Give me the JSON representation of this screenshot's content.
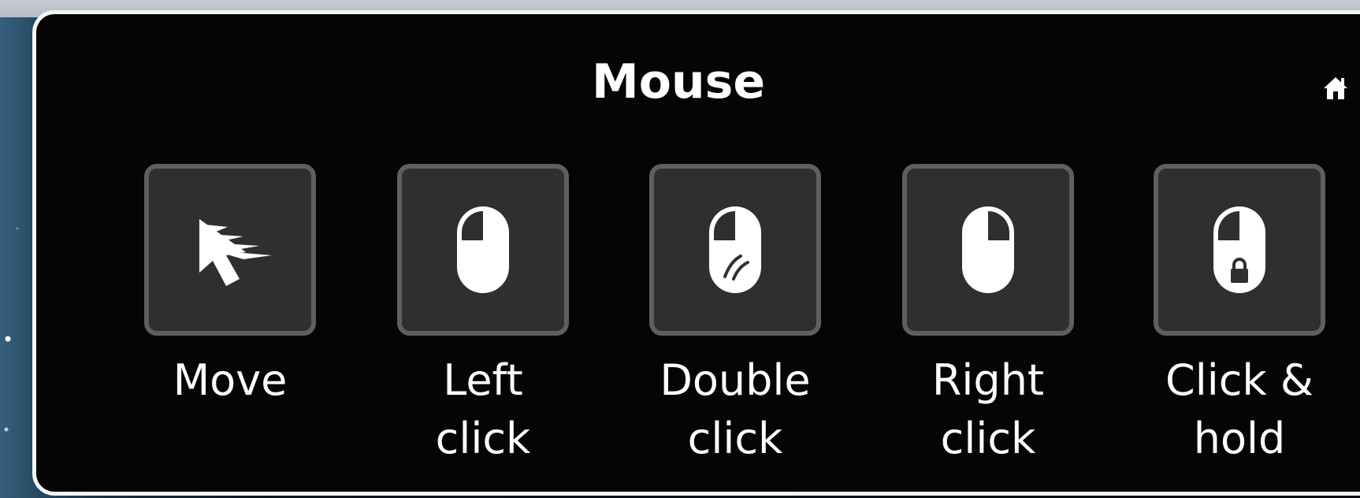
{
  "panel": {
    "title": "Mouse",
    "home_icon": "home-icon"
  },
  "tools": {
    "move": {
      "label_line_1": "Move",
      "icon": "move-cursor-icon"
    },
    "left_click": {
      "label_line_1": "Left",
      "label_line_2": "click",
      "icon": "left-click-mouse-icon"
    },
    "double_click": {
      "label_line_1": "Double",
      "label_line_2": "click",
      "icon": "double-click-mouse-icon"
    },
    "right_click": {
      "label_line_1": "Right",
      "label_line_2": "click",
      "icon": "right-click-mouse-icon"
    },
    "click_hold": {
      "label_line_1": "Click &",
      "label_line_2": "hold",
      "icon": "click-hold-mouse-icon"
    }
  },
  "colors": {
    "panel_background": "#050505",
    "panel_border": "#f5f5f5",
    "button_background": "#2f2f2f",
    "button_border": "#5f5f5f",
    "text": "#ffffff"
  }
}
